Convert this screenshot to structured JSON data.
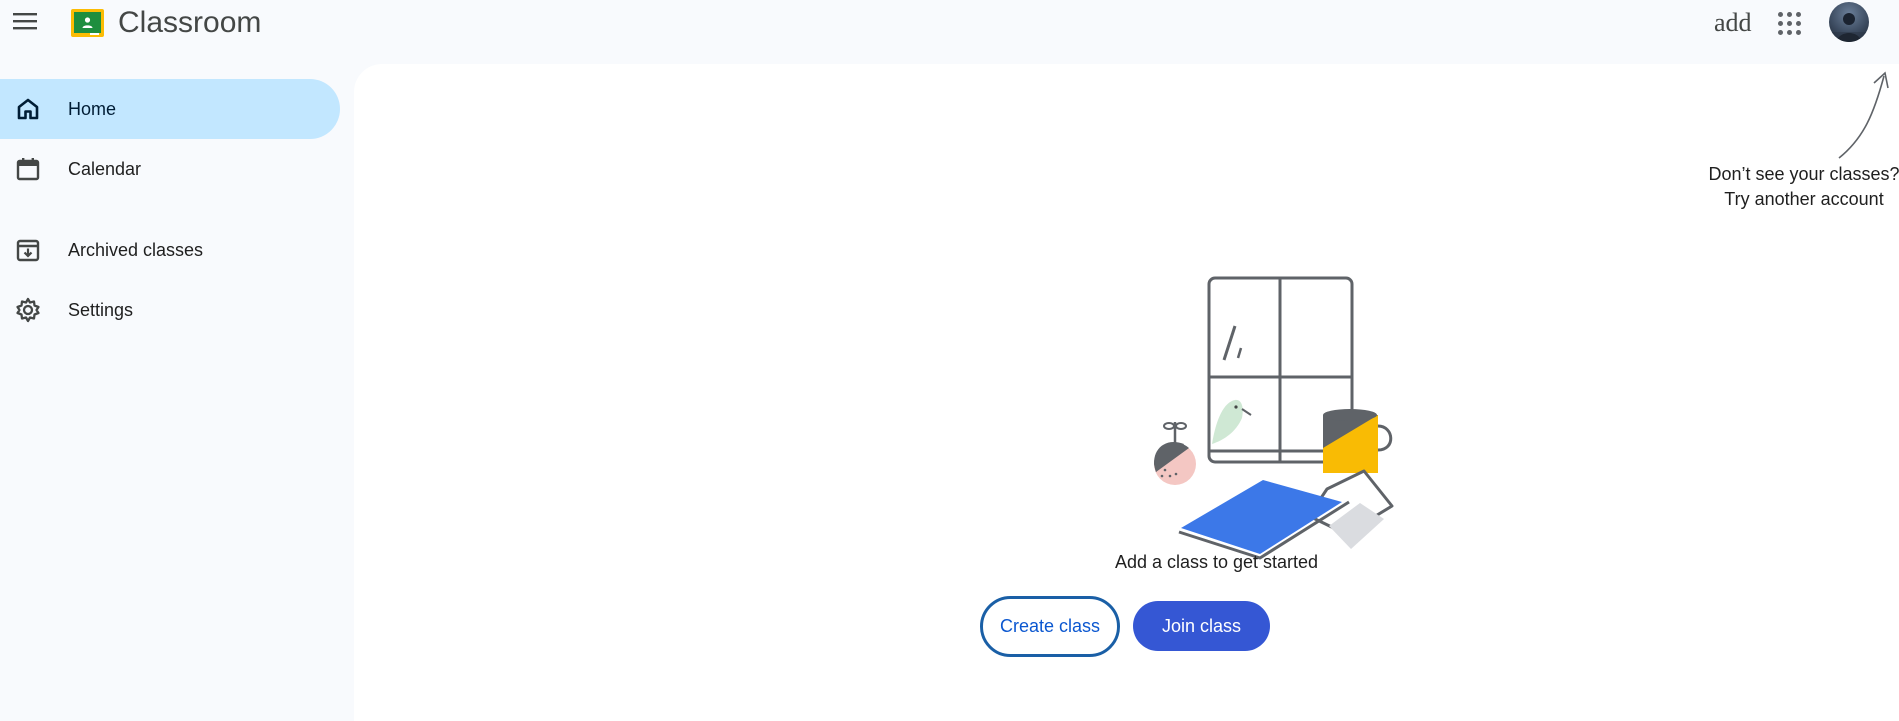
{
  "app": {
    "title": "Classroom"
  },
  "header": {
    "add_label": "add",
    "menu_icon": "hamburger-menu-icon",
    "apps_icon": "google-apps-icon",
    "avatar_icon": "account-avatar"
  },
  "sidebar": {
    "items": [
      {
        "label": "Home",
        "icon": "home-icon",
        "active": true
      },
      {
        "label": "Calendar",
        "icon": "calendar-icon",
        "active": false
      },
      {
        "label": "Archived classes",
        "icon": "archive-icon",
        "active": false
      },
      {
        "label": "Settings",
        "icon": "settings-gear-icon",
        "active": false
      }
    ]
  },
  "main": {
    "hint_line1": "Don’t see your classes?",
    "hint_line2": "Try another account",
    "empty_state_text": "Add a class to get started",
    "create_class_label": "Create class",
    "join_class_label": "Join class"
  },
  "colors": {
    "sidebar_active": "#c2e7ff",
    "primary_button": "#3557d4",
    "outline_button_border": "#1a5fa6",
    "page_background": "#f8fafd",
    "panel_background": "#ffffff",
    "logo_green": "#1e8e3e",
    "logo_yellow": "#fbbc04"
  }
}
